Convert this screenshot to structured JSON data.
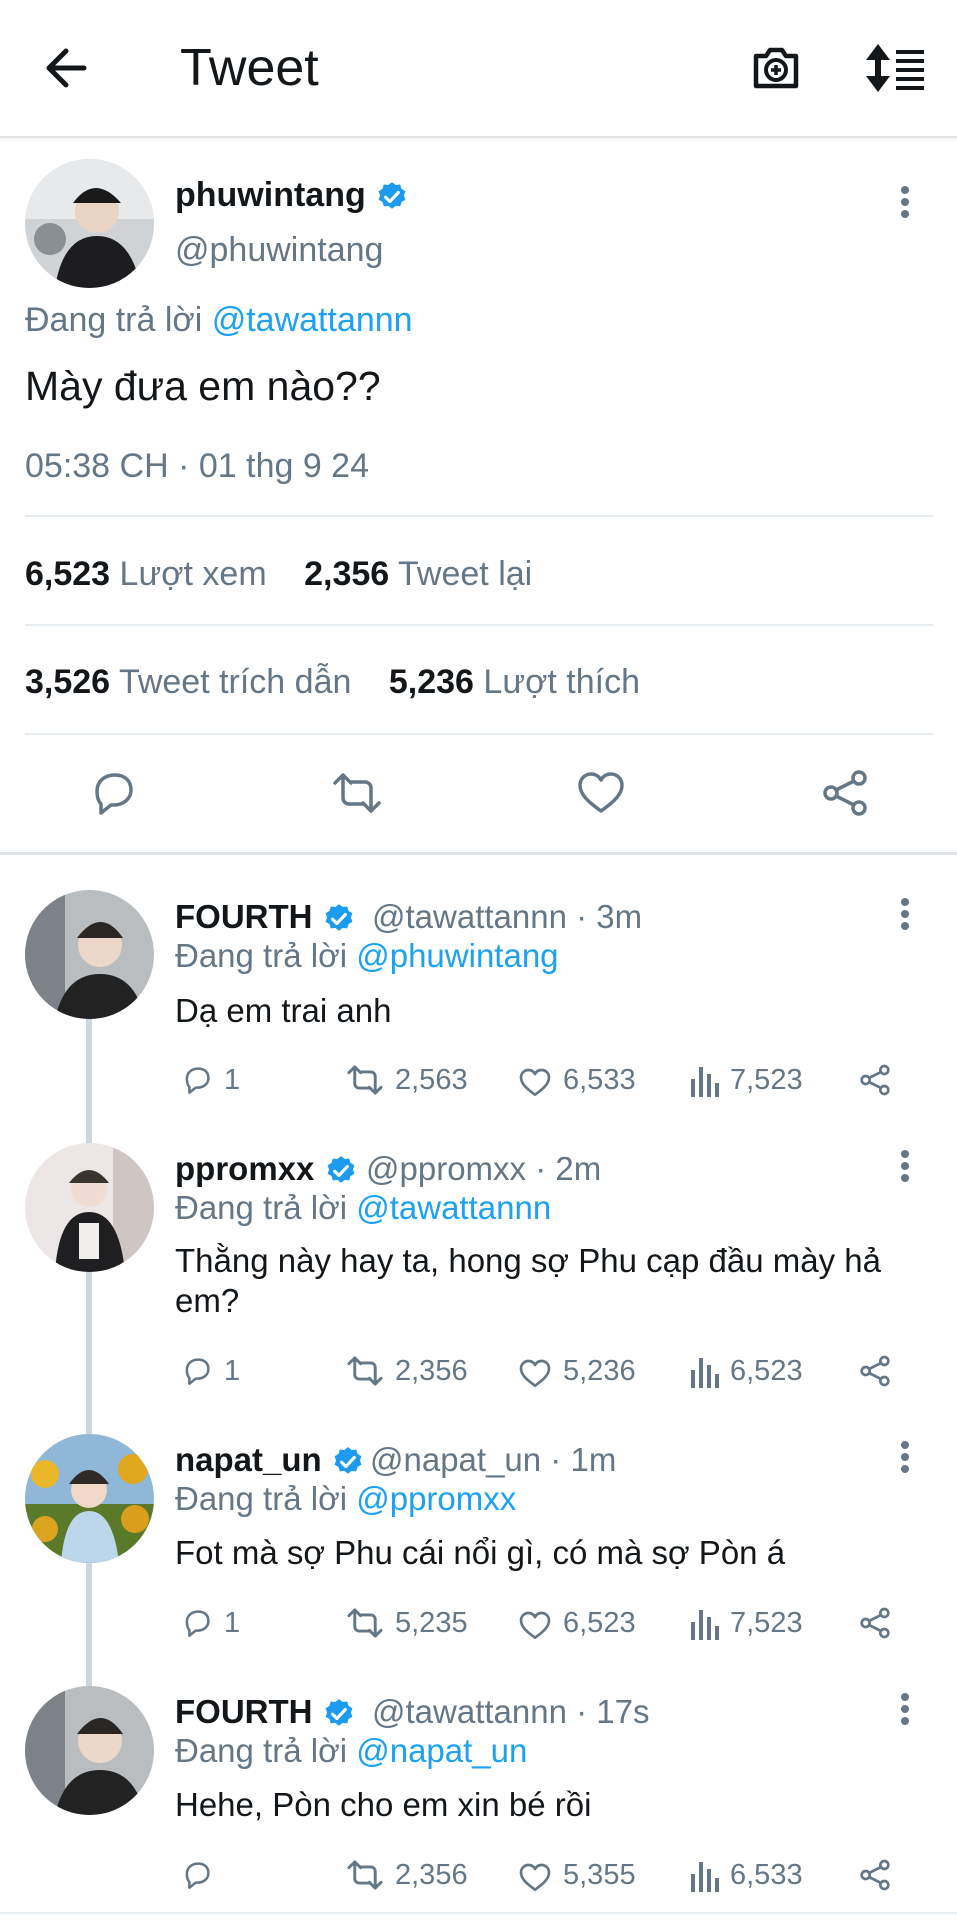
{
  "header": {
    "title": "Tweet"
  },
  "main_tweet": {
    "name": "phuwintang",
    "handle": "@phuwintang",
    "replying_prefix": "Đang trả lời",
    "replying_to": "@tawattannn",
    "text": "Mày đưa em nào??",
    "timestamp": "05:38 CH · 01 thg 9 24",
    "stats": {
      "views_count": "6,523",
      "views_label": "Lượt xem",
      "retweets_count": "2,356",
      "retweets_label": "Tweet lại",
      "quotes_count": "3,526",
      "quotes_label": "Tweet trích dẫn",
      "likes_count": "5,236",
      "likes_label": "Lượt thích"
    }
  },
  "replies": [
    {
      "name": "FOURTH",
      "handle": "@tawattannn · 3m",
      "replying_prefix": "Đang trả lời",
      "replying_to": "@phuwintang",
      "text": "Dạ em trai anh",
      "replies": "1",
      "retweets": "2,563",
      "likes": "6,533",
      "views": "7,523"
    },
    {
      "name": "ppromxx",
      "handle": "@ppromxx · 2m",
      "replying_prefix": "Đang trả lời",
      "replying_to": "@tawattannn",
      "text": "Thằng này hay ta, hong sợ Phu cạp đầu mày hả em?",
      "replies": "1",
      "retweets": "2,356",
      "likes": "5,236",
      "views": "6,523"
    },
    {
      "name": "napat_un",
      "handle": "@napat_un · 1m",
      "replying_prefix": "Đang trả lời",
      "replying_to": "@ppromxx",
      "text": "Fot mà sợ Phu cái nổi gì, có mà sợ Pòn á",
      "replies": "1",
      "retweets": "5,235",
      "likes": "6,523",
      "views": "7,523"
    },
    {
      "name": "FOURTH",
      "handle": "@tawattannn · 17s",
      "replying_prefix": "Đang trả lời",
      "replying_to": "@napat_un",
      "text": "Hehe, Pòn cho em xin bé rồi",
      "replies": "",
      "retweets": "2,356",
      "likes": "5,355",
      "views": "6,533"
    }
  ],
  "colors": {
    "accent": "#1da1f2",
    "text": "#14171a",
    "secondary": "#657786",
    "divider": "#e6ecf0"
  },
  "icons": [
    "back-arrow-icon",
    "camera-add-icon",
    "sort-icon",
    "verified-icon",
    "more-vertical-icon",
    "reply-icon",
    "retweet-icon",
    "like-icon",
    "share-icon",
    "views-icon"
  ]
}
